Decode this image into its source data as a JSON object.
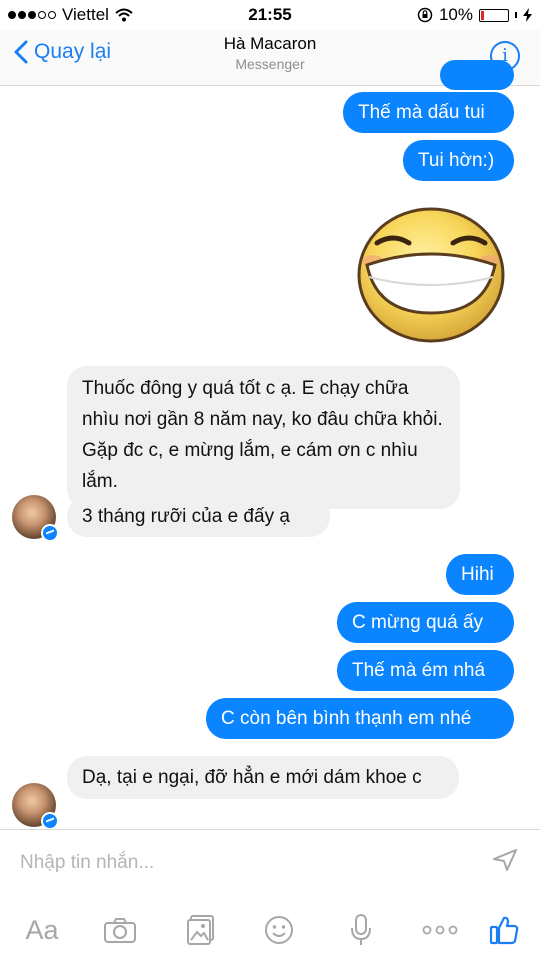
{
  "status": {
    "carrier": "Viettel",
    "time": "21:55",
    "battery": "10%",
    "battery_level": 0.1
  },
  "nav": {
    "back_label": "Quay lại",
    "title": "Hà Macaron",
    "subtitle": "Messenger"
  },
  "messages": [
    {
      "from": "me",
      "text": "Thế mà dấu tui"
    },
    {
      "from": "me",
      "text": "Tui hờn:)"
    },
    {
      "from": "me",
      "type": "sticker",
      "sticker": "laughing-face-sticker"
    },
    {
      "from": "them",
      "text": "Thuốc đông y quá tốt c ạ. E chạy chữa nhìu nơi gần 8 năm nay, ko đâu chữa khỏi. Gặp đc c, e mừng lắm, e cám ơn c nhìu lắm."
    },
    {
      "from": "them",
      "text": "3 tháng rưỡi của e đấy ạ"
    },
    {
      "from": "me",
      "text": "Hihi"
    },
    {
      "from": "me",
      "text": "C mừng quá ấy"
    },
    {
      "from": "me",
      "text": "Thế mà ém nhá"
    },
    {
      "from": "me",
      "text": "C còn bên bình thạnh em nhé"
    },
    {
      "from": "them",
      "text": "Dạ, tại e ngại, đỡ hẳn e mới dám khoe c"
    }
  ],
  "composer": {
    "placeholder": "Nhập tin nhắn...",
    "aa_label": "Aa"
  },
  "icons": [
    "chevron-left-icon",
    "info-icon",
    "send-icon",
    "camera-icon",
    "photo-icon",
    "emoji-icon",
    "microphone-icon",
    "more-icon",
    "thumbs-up-icon"
  ],
  "colors": {
    "accent": "#0a84ff",
    "received_bubble": "#f0f0f0",
    "battery_low": "#e0242a"
  }
}
